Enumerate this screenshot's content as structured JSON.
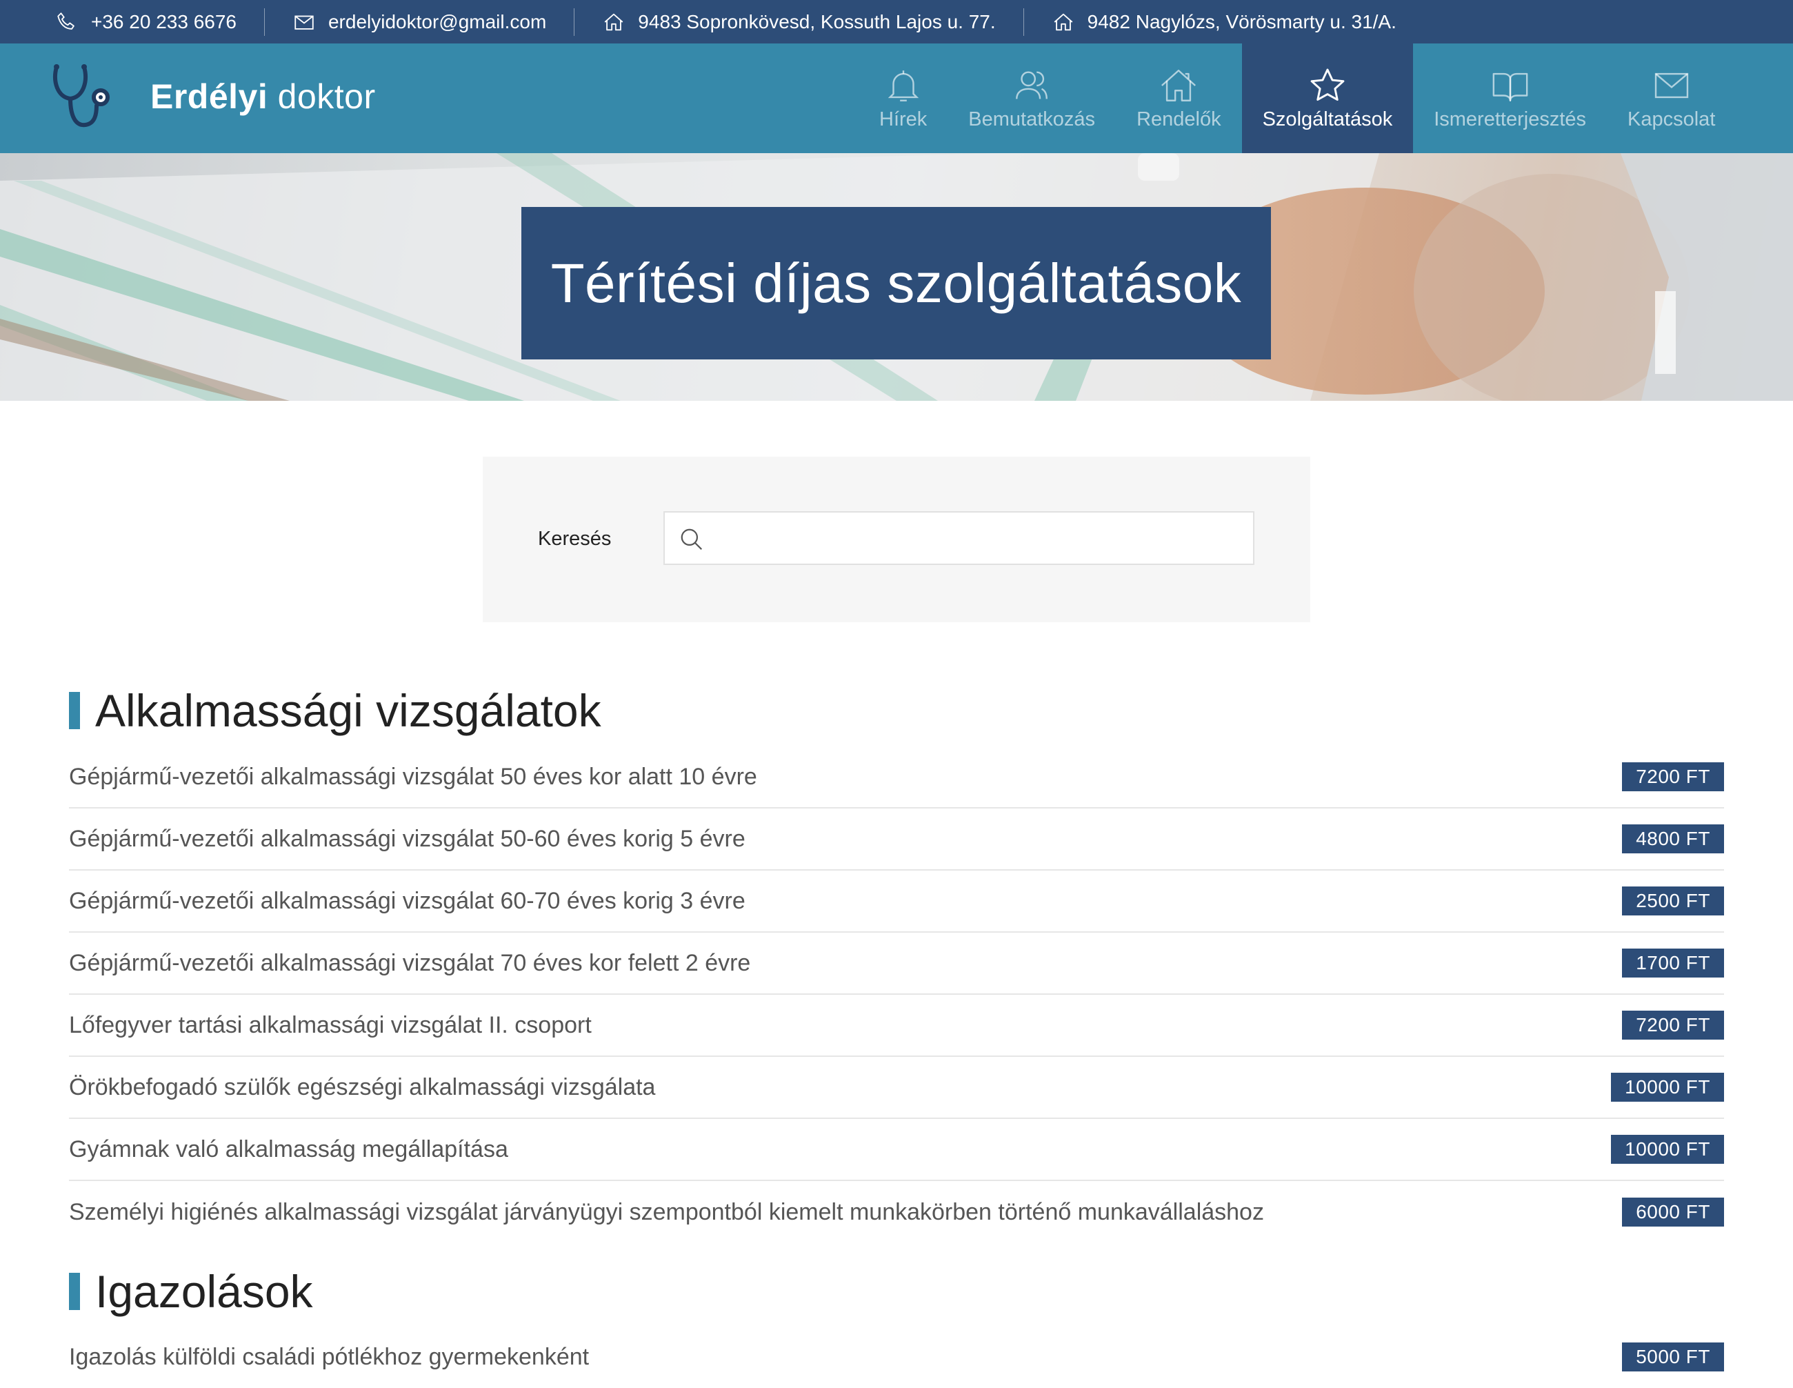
{
  "topbar": {
    "phone": "+36 20 233 6676",
    "email": "erdelyidoktor@gmail.com",
    "address1": "9483 Sopronkövesd, Kossuth Lajos u. 77.",
    "address2": "9482 Nagylózs, Vörösmarty u. 31/A."
  },
  "brand": {
    "bold": "Erdélyi",
    "light": "doktor"
  },
  "nav": [
    {
      "label": "Hírek",
      "icon": "bell-icon"
    },
    {
      "label": "Bemutatkozás",
      "icon": "users-icon"
    },
    {
      "label": "Rendelők",
      "icon": "house-icon"
    },
    {
      "label": "Szolgáltatások",
      "icon": "star-icon",
      "active": true
    },
    {
      "label": "Ismeretterjesztés",
      "icon": "book-icon"
    },
    {
      "label": "Kapcsolat",
      "icon": "envelope-icon"
    }
  ],
  "hero": {
    "title": "Térítési díjas szolgáltatások"
  },
  "search": {
    "label": "Keresés",
    "placeholder": "",
    "value": ""
  },
  "sections": [
    {
      "title": "Alkalmassági vizsgálatok",
      "items": [
        {
          "name": "Gépjármű-vezetői alkalmassági vizsgálat 50 éves kor alatt 10 évre",
          "price": "7200 FT"
        },
        {
          "name": "Gépjármű-vezetői alkalmassági vizsgálat 50-60 éves korig 5 évre",
          "price": "4800 FT"
        },
        {
          "name": "Gépjármű-vezetői alkalmassági vizsgálat 60-70 éves korig 3 évre",
          "price": "2500 FT"
        },
        {
          "name": "Gépjármű-vezetői alkalmassági vizsgálat 70 éves kor felett 2 évre",
          "price": "1700 FT"
        },
        {
          "name": "Lőfegyver tartási alkalmassági vizsgálat II. csoport",
          "price": "7200 FT"
        },
        {
          "name": "Örökbefogadó szülők egészségi alkalmassági vizsgálata",
          "price": "10000 FT"
        },
        {
          "name": "Gyámnak való alkalmasság megállapítása",
          "price": "10000 FT"
        },
        {
          "name": "Személyi higiénés alkalmassági vizsgálat járványügyi szempontból kiemelt munkakörben történő munkavállaláshoz",
          "price": "6000 FT"
        }
      ]
    },
    {
      "title": "Igazolások",
      "items": [
        {
          "name": "Igazolás külföldi családi pótlékhoz gyermekenként",
          "price": "5000 FT"
        }
      ]
    }
  ],
  "colors": {
    "topbar": "#2d4d78",
    "header": "#3689aa",
    "active_nav": "#2d4d78",
    "price_badge": "#2d4d78",
    "section_accent": "#3689aa"
  }
}
